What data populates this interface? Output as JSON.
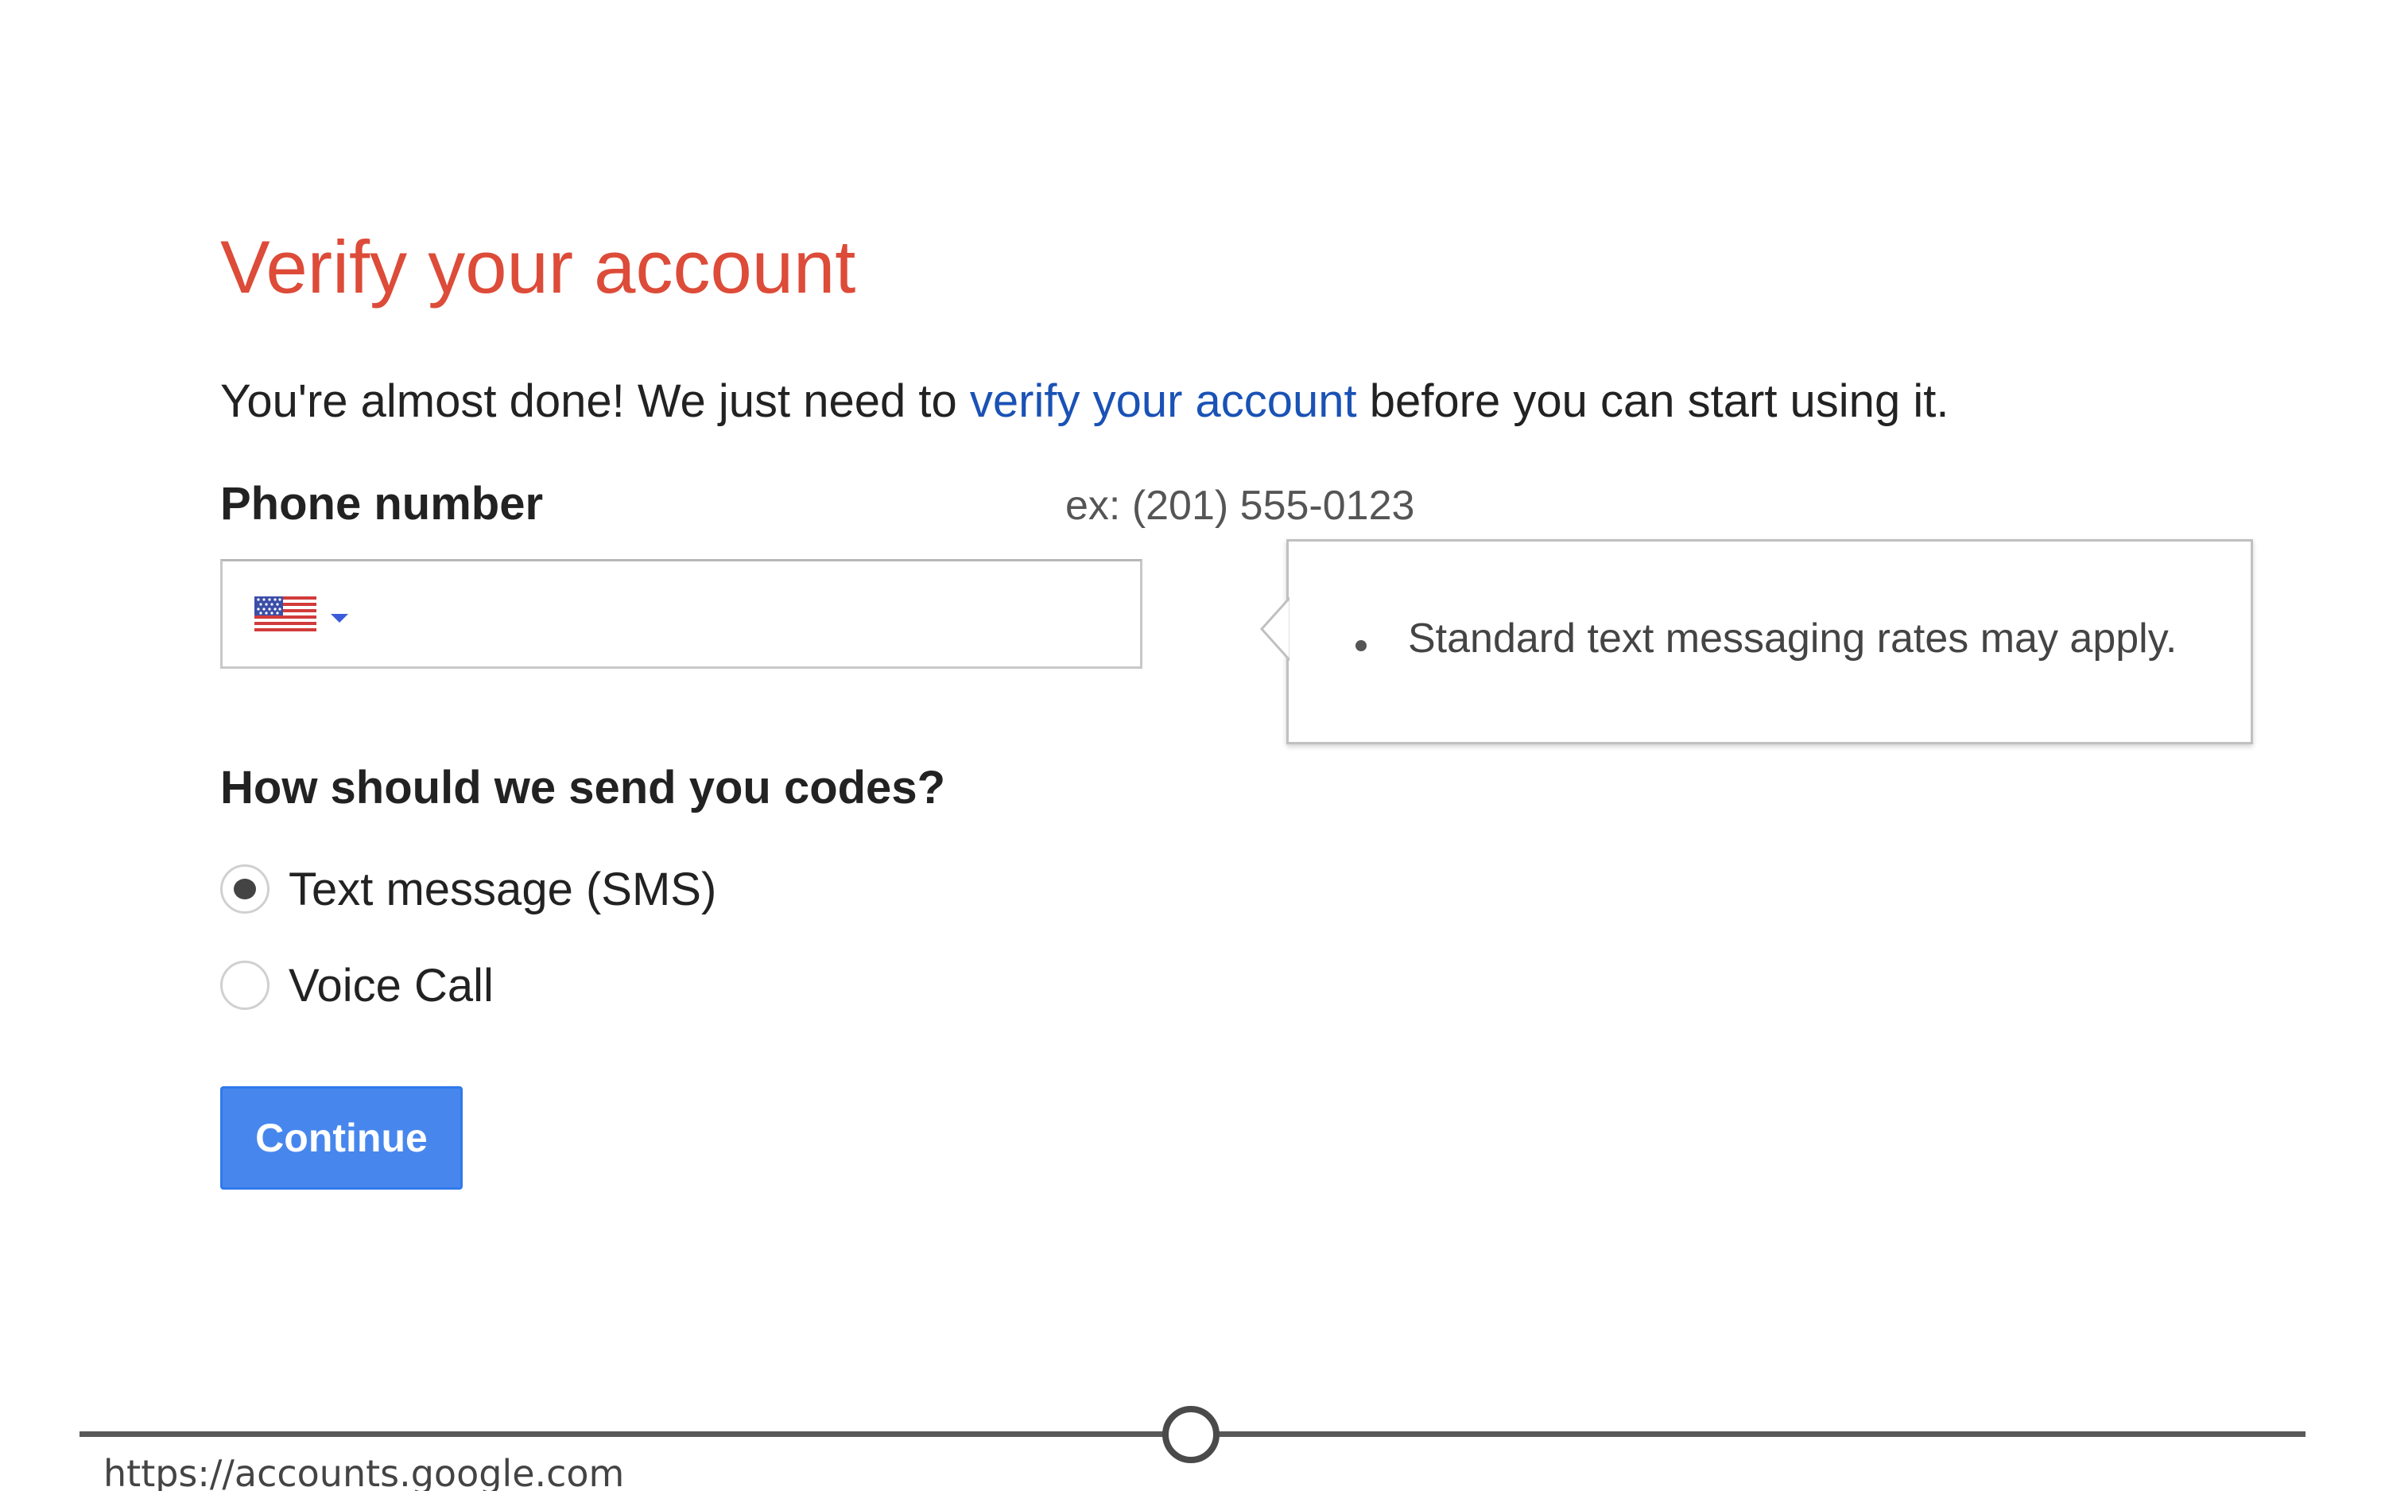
{
  "heading": {
    "title": "Verify your account"
  },
  "intro": {
    "before": "You're almost done! We just need to ",
    "link": "verify your account",
    "after": " before you can start using it."
  },
  "phone": {
    "label": "Phone number",
    "example": "ex: (201) 555-0123",
    "value": "",
    "country_icon": "us-flag-icon"
  },
  "tooltip": {
    "items": [
      "Standard text messaging rates may apply."
    ]
  },
  "codes": {
    "label": "How should we send you codes?",
    "options": [
      {
        "label": "Text message (SMS)",
        "selected": true
      },
      {
        "label": "Voice Call",
        "selected": false
      }
    ]
  },
  "actions": {
    "continue_label": "Continue"
  },
  "footer": {
    "url": "https://accounts.google.com"
  },
  "colors": {
    "title": "#dd4b39",
    "link": "#1a52b5",
    "button": "#4787ed"
  }
}
